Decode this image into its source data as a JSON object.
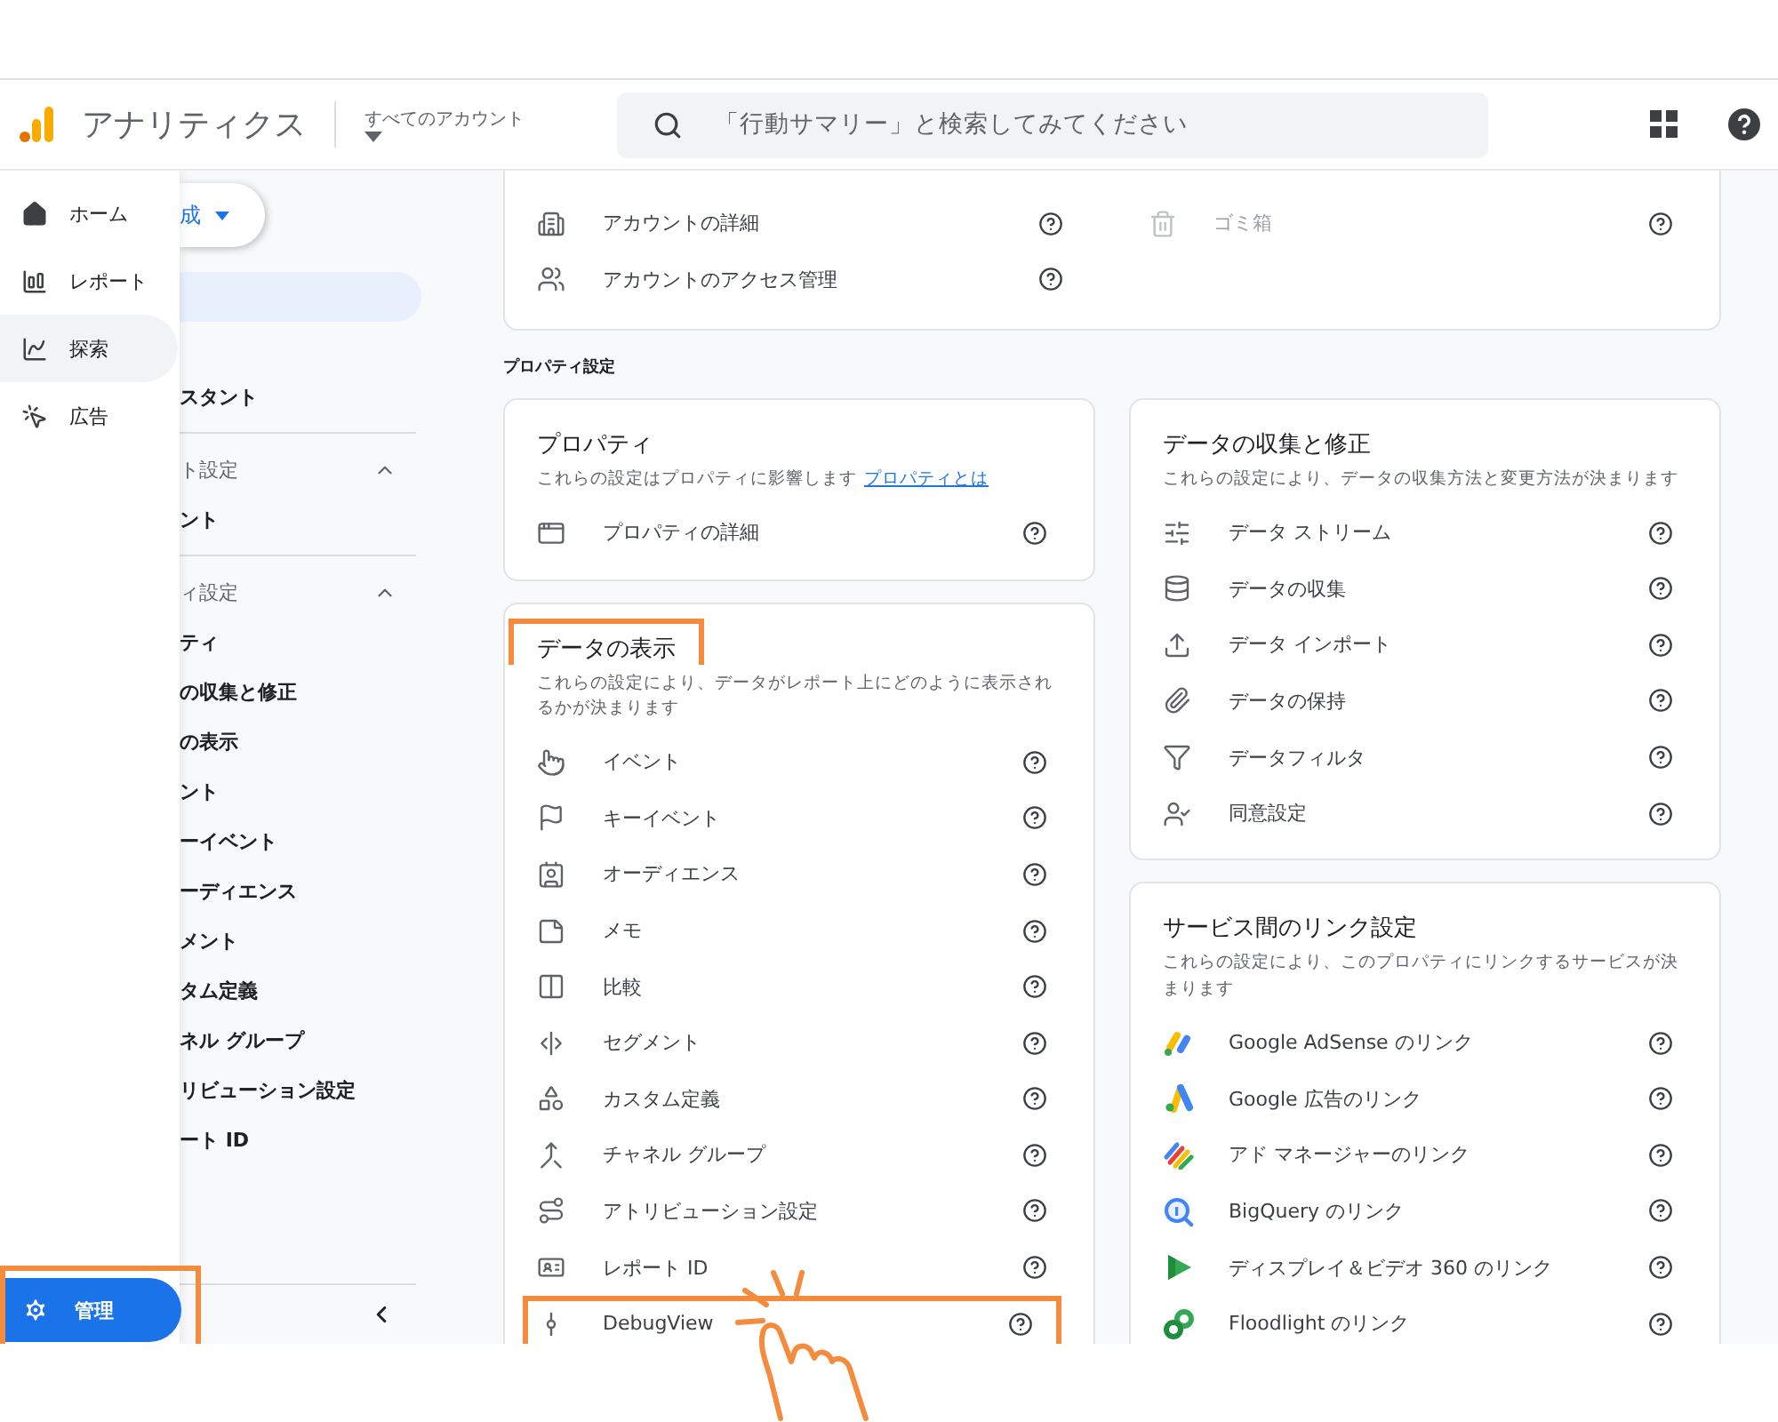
{
  "header": {
    "app_name": "アナリティクス",
    "account_picker": "すべてのアカウント",
    "search": {
      "placeholder": "「行動サマリー」と検索してみてください"
    }
  },
  "nav_drawer": {
    "items": [
      {
        "label": "ホーム",
        "selected": false
      },
      {
        "label": "レポート",
        "selected": false
      },
      {
        "label": "探索",
        "selected": true
      },
      {
        "label": "広告",
        "selected": false
      }
    ],
    "admin": {
      "label": "管理",
      "highlighted": true
    }
  },
  "sidebar": {
    "create_button": "成",
    "items": [
      {
        "kind": "item",
        "label": "スタント"
      },
      {
        "kind": "section",
        "label": "ト設定",
        "expanded": true
      },
      {
        "kind": "item",
        "label": "ント"
      },
      {
        "kind": "section",
        "label": "ィ設定",
        "expanded": true
      },
      {
        "kind": "item",
        "label": "ティ"
      },
      {
        "kind": "item",
        "label": "の収集と修正"
      },
      {
        "kind": "item",
        "label": "の表示"
      },
      {
        "kind": "item",
        "label": "ント"
      },
      {
        "kind": "item",
        "label": "ーイベント"
      },
      {
        "kind": "item",
        "label": "ーディエンス"
      },
      {
        "kind": "item",
        "label": "メント"
      },
      {
        "kind": "item",
        "label": "タム定義"
      },
      {
        "kind": "item",
        "label": "ネル グループ"
      },
      {
        "kind": "item",
        "label": "リビューション設定"
      },
      {
        "kind": "item",
        "label": "ート ID"
      }
    ]
  },
  "account_card": {
    "left_rows": [
      {
        "label": "アカウントの詳細",
        "disabled": false
      },
      {
        "label": "アカウントのアクセス管理",
        "disabled": false
      }
    ],
    "right_rows": [
      {
        "label": "ゴミ箱",
        "disabled": true
      }
    ]
  },
  "property_settings": {
    "heading": "プロパティ設定",
    "columns": [
      [
        {
          "title": "プロパティ",
          "description": "これらの設定はプロパティに影響します",
          "link": "プロパティとは",
          "highlighted": false,
          "rows": [
            {
              "label": "プロパティの詳細",
              "highlighted": false
            }
          ]
        },
        {
          "title": "データの表示",
          "description": "これらの設定により、データがレポート上にどのように表示されるかが決まります",
          "highlighted": true,
          "rows": [
            {
              "label": "イベント",
              "highlighted": false
            },
            {
              "label": "キーイベント",
              "highlighted": false
            },
            {
              "label": "オーディエンス",
              "highlighted": false
            },
            {
              "label": "メモ",
              "highlighted": false
            },
            {
              "label": "比較",
              "highlighted": false
            },
            {
              "label": "セグメント",
              "highlighted": false
            },
            {
              "label": "カスタム定義",
              "highlighted": false
            },
            {
              "label": "チャネル グループ",
              "highlighted": false
            },
            {
              "label": "アトリビューション設定",
              "highlighted": false
            },
            {
              "label": "レポート ID",
              "highlighted": false
            },
            {
              "label": "DebugView",
              "highlighted": true
            }
          ]
        }
      ],
      [
        {
          "title": "データの収集と修正",
          "description": "これらの設定により、データの収集方法と変更方法が決まります",
          "highlighted": false,
          "rows": [
            {
              "label": "データ ストリーム",
              "highlighted": false
            },
            {
              "label": "データの収集",
              "highlighted": false
            },
            {
              "label": "データ インポート",
              "highlighted": false
            },
            {
              "label": "データの保持",
              "highlighted": false
            },
            {
              "label": "データフィルタ",
              "highlighted": false
            },
            {
              "label": "同意設定",
              "highlighted": false
            }
          ]
        },
        {
          "title": "サービス間のリンク設定",
          "description": "これらの設定により、このプロパティにリンクするサービスが決まります",
          "highlighted": false,
          "rows": [
            {
              "label": "Google AdSense のリンク",
              "kind": "service",
              "highlighted": false
            },
            {
              "label": "Google 広告のリンク",
              "kind": "service",
              "highlighted": false
            },
            {
              "label": "アド マネージャーのリンク",
              "kind": "service",
              "highlighted": false
            },
            {
              "label": "BigQuery のリンク",
              "kind": "service",
              "highlighted": false
            },
            {
              "label": "ディスプレイ＆ビデオ 360 のリンク",
              "kind": "service",
              "highlighted": false
            },
            {
              "label": "Floodlight のリンク",
              "kind": "service",
              "highlighted": false
            }
          ]
        }
      ]
    ]
  }
}
